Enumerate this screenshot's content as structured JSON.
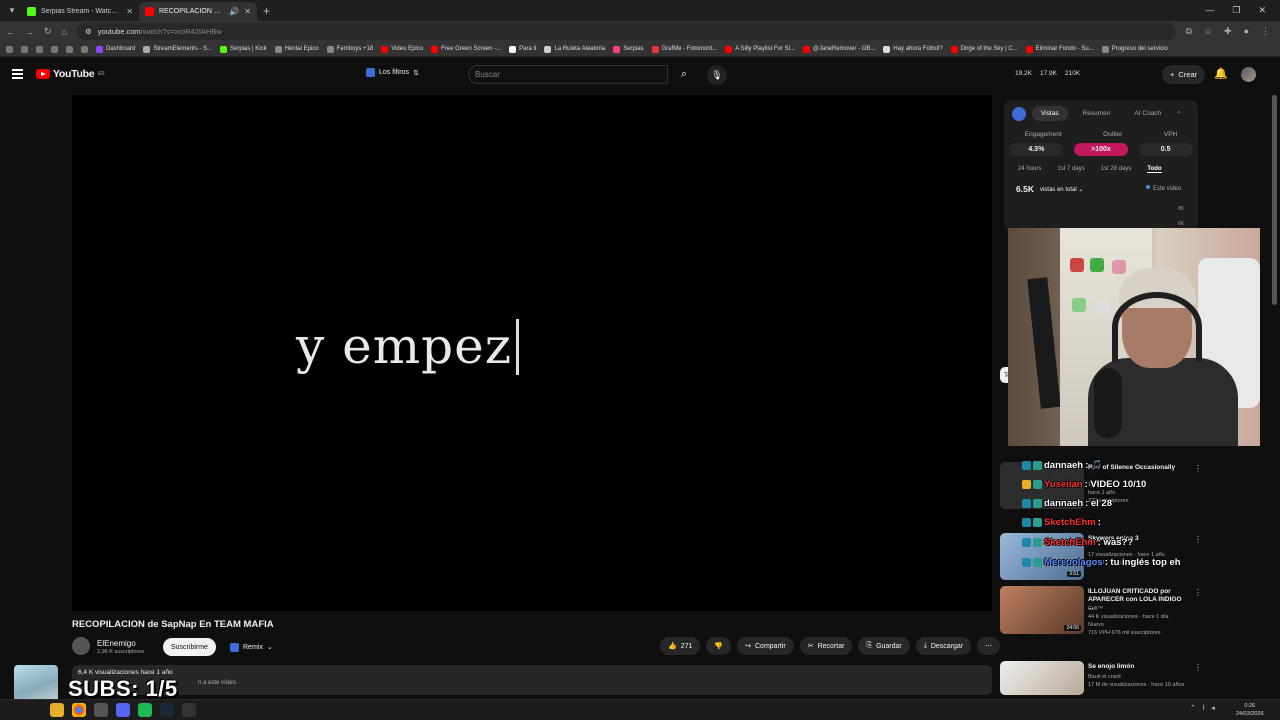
{
  "browser": {
    "tabs": [
      {
        "title": "Serpias Stream - Watch Live on",
        "active": false,
        "color": "#53fc18"
      },
      {
        "title": "RECOPILACION de SapNap",
        "active": true,
        "color": "#ff0000"
      }
    ],
    "url": "youtube.com",
    "url_rest": "/watch?v=xroR42IAHBw",
    "bookmarks": [
      {
        "label": "Dashboard",
        "color": "#9146ff"
      },
      {
        "label": "StreamElements - S...",
        "color": "#aaaaaa"
      },
      {
        "label": "Serpias | Kick",
        "color": "#53fc18"
      },
      {
        "label": "Hentai Epico",
        "color": "#888888"
      },
      {
        "label": "Femboys +18",
        "color": "#888888"
      },
      {
        "label": "Video Epico",
        "color": "#ff0000"
      },
      {
        "label": "Free Green Screen -...",
        "color": "#ff0000"
      },
      {
        "label": "Para ti",
        "color": "#ffffff"
      },
      {
        "label": "La Ruleta Aleatoria",
        "color": "#cccccc"
      },
      {
        "label": "Serpias",
        "color": "#ff4081"
      },
      {
        "label": "GrafMe - Fotomont...",
        "color": "#e53935"
      },
      {
        "label": "A Silly Playlist For Si...",
        "color": "#ff0000"
      },
      {
        "label": "@JaneRemover - OB...",
        "color": "#ff0000"
      },
      {
        "label": "Hay ahora Fútbol?",
        "color": "#dddddd"
      },
      {
        "label": "Dirge of the Sky | C...",
        "color": "#ff0000"
      },
      {
        "label": "Eliminar Fondo - Su...",
        "color": "#ff0000"
      },
      {
        "label": "Progreso del servicio",
        "color": "#888888"
      }
    ]
  },
  "header": {
    "logo": "YouTube",
    "logo_sup": "ES",
    "filters": "Los filtros",
    "search_placeholder": "Buscar",
    "stats": [
      "19.2K",
      "17.9K",
      "210K"
    ],
    "create": "Crear"
  },
  "video": {
    "overlay_text": "y empez",
    "title": "RECOPILACION de SapNap En TEAM MAFIA",
    "channel": "ElEnemigo",
    "channel_subs": "2,96 K suscriptores",
    "subscribe": "Suscribirme",
    "remix": "Remix",
    "likes": "271",
    "share": "Compartir",
    "clip": "Recortar",
    "save": "Guardar",
    "download": "Descargar",
    "meta": "6,4 K visualizaciones  hace 1 año",
    "desc_tail": "n a este vídeo."
  },
  "stream_overlay": {
    "subs": "SUBS: 1/5"
  },
  "analytics": {
    "tabs": [
      "Vistas",
      "Resumen",
      "AI Coach"
    ],
    "metrics": [
      {
        "label": "Engagement",
        "value": "4.3%"
      },
      {
        "label": "Outlier",
        "value": ">100x"
      },
      {
        "label": "VPH",
        "value": "0.5"
      }
    ],
    "ranges": [
      "24 hours",
      "1st 7 days",
      "1st 28 days",
      "Todo"
    ],
    "views_total": "6.5K",
    "views_label": "vistas en total",
    "this_video": "Este vídeo",
    "ticks": [
      "8K",
      "6K"
    ]
  },
  "sidebar": {
    "chip": "Todo",
    "recommendations": [
      {
        "title": "Rod of Silence Occasionally",
        "meta": [
          "1,551.53",
          "hace 1 año",
          "272 suscriptores"
        ],
        "thumb": "#2d2d2d"
      },
      {
        "title": "Skywars epico 3",
        "meta": [
          "17 visualizaciones · hace 1 año",
          "1 VPH  1 suscriptores"
        ],
        "thumb": "#6a8ab0",
        "dur": "3:51"
      },
      {
        "title": "ILLOJUAN CRITICADO por APARECER con LOLA INDIGO ...",
        "meta": [
          "Cell™",
          "44 K visualizaciones · hace 1 día",
          "Nuevo",
          "716 VPH  676 mil suscriptores"
        ],
        "thumb": "#8a5a40",
        "dur": "24:06"
      },
      {
        "title": "Se enojo limón",
        "meta": [
          "Bauti el crack",
          "17 M de visualizaciones · hace 10 años"
        ],
        "thumb": "#d8d0c0"
      }
    ]
  },
  "chat": [
    {
      "user": "dannaeh",
      "msg": ": 🎵",
      "color": "#ffffff"
    },
    {
      "user": "Yuseiian",
      "msg": ": VIDEO 10/10",
      "color": "#ff3030"
    },
    {
      "user": "dannaeh",
      "msg": ": el 28",
      "color": "#ffffff"
    },
    {
      "user": "SketchEhm",
      "msg": ":",
      "color": "#ff3030"
    },
    {
      "user": "SketchEhm",
      "msg": ": was??",
      "color": "#ff3030"
    },
    {
      "user": "Mereuolagos",
      "msg": ": tu inglés top eh",
      "color": "#5b8cff"
    }
  ],
  "taskbar": {
    "time": "0:26",
    "date": "24/03/2026"
  }
}
